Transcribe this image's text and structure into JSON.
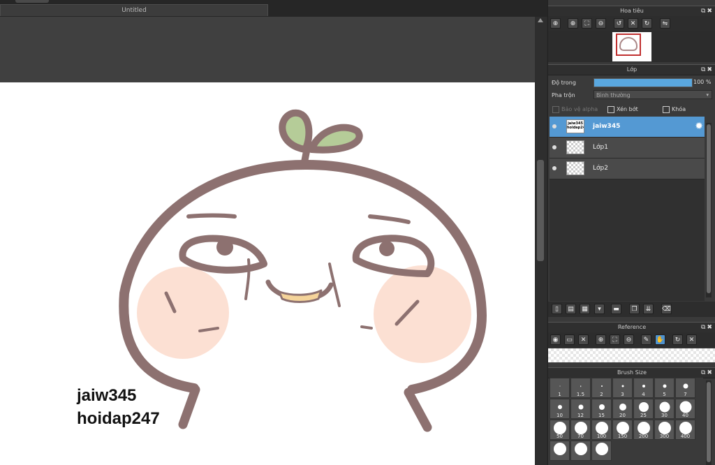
{
  "document": {
    "tab_title": "Untitled"
  },
  "canvas": {
    "watermark_lines": [
      "jaiw345",
      "hoidap247"
    ]
  },
  "navigator": {
    "title": "Hoa tiêu",
    "tools": [
      "zoom-in-icon",
      "zoom-in-icon",
      "fit-screen-icon",
      "zoom-out-icon",
      "rotate-left-icon",
      "actual-size-icon",
      "rotate-right-icon",
      "flip-icon"
    ]
  },
  "layer_panel": {
    "title": "Lớp",
    "opacity_label": "Độ trong",
    "opacity_value": "100 %",
    "opacity_fraction": 1.0,
    "blend_label": "Pha trộn",
    "blend_value": "Bình thường",
    "checkboxes": {
      "protect_alpha": "Bảo vệ alpha",
      "clipping": "Xén bớt",
      "lock": "Khóa"
    },
    "layers": [
      {
        "name": "jaiw345",
        "selected": true,
        "thumb_text": "jaiw345 hoidap247"
      },
      {
        "name": "Lớp1",
        "selected": false
      },
      {
        "name": "Lớp2",
        "selected": false
      }
    ]
  },
  "reference": {
    "title": "Reference"
  },
  "brush_size": {
    "title": "Brush Size",
    "sizes": [
      "1",
      "1.5",
      "2",
      "3",
      "4",
      "5",
      "7",
      "10",
      "12",
      "15",
      "20",
      "25",
      "30",
      "40",
      "50",
      "70",
      "100",
      "150",
      "200",
      "300",
      "400"
    ]
  },
  "panel_buttons": "⧉✖",
  "colors": {
    "accent": "#5499d3",
    "panel_bg": "#3a3a3a",
    "canvas_bg": "#404040",
    "stroke": "#8d7170",
    "blush": "#fbd6c4",
    "sprout": "#b5cc98"
  }
}
